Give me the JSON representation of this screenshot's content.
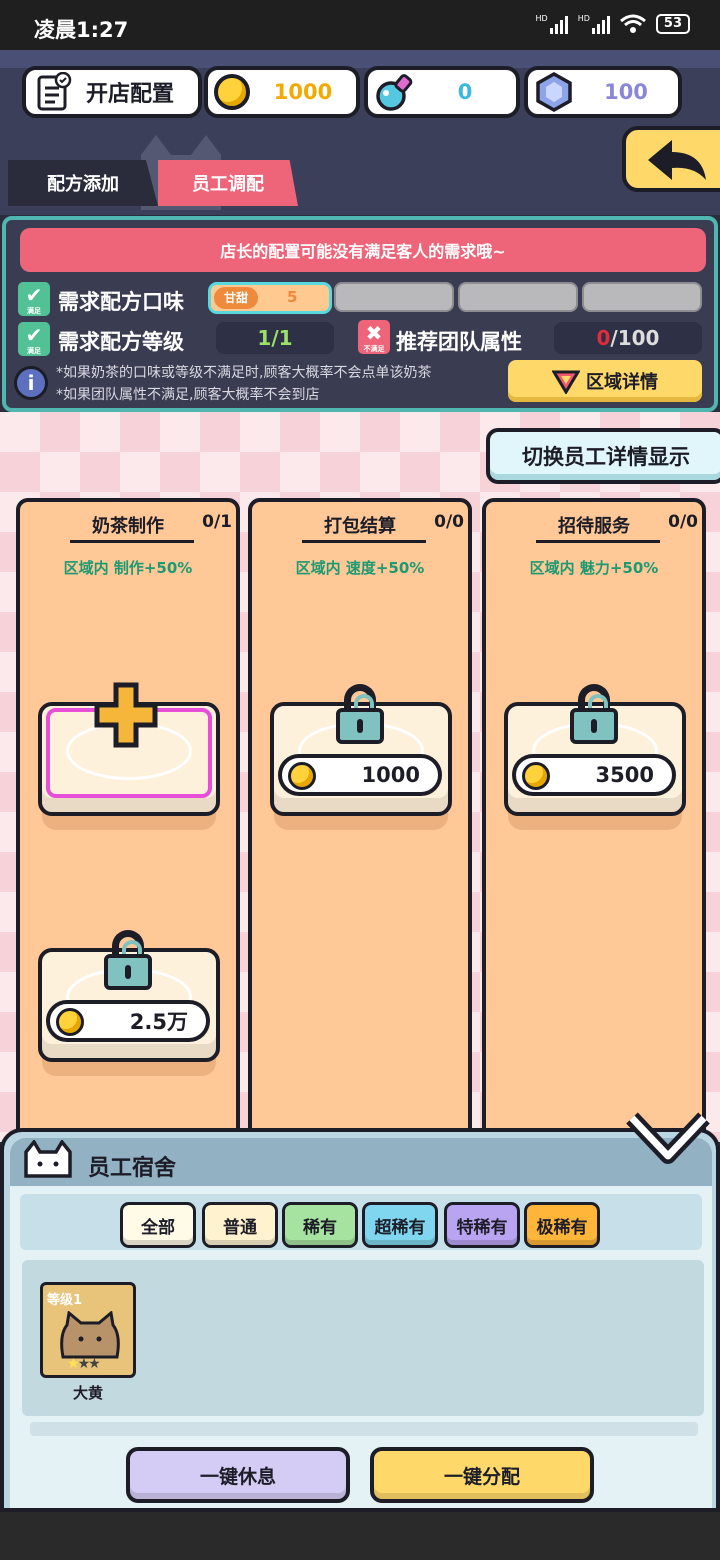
{
  "status_bar": {
    "time": "凌晨1:27",
    "battery": "53",
    "signal1": "HD",
    "signal2": "HD"
  },
  "header": {
    "title": "开店配置",
    "coins": "1000",
    "potion": "0",
    "gems": "100"
  },
  "tabs": [
    {
      "label": "配方添加"
    },
    {
      "label": "员工调配"
    }
  ],
  "info": {
    "warning": "店长的配置可能没有满足客人的需求哦~",
    "req_flavor": {
      "label": "需求配方口味",
      "status": "满足",
      "tag": "甘甜",
      "value": "5"
    },
    "req_level": {
      "label": "需求配方等级",
      "status": "满足",
      "value": "1/1"
    },
    "team": {
      "label": "推荐团队属性",
      "status": "不满足",
      "value_cur": "0",
      "value_total": "/100"
    },
    "notes": [
      "*如果奶茶的口味或等级不满足时,顾客大概率不会点单该奶茶",
      "*如果团队属性不满足,顾客大概率不会到店"
    ],
    "area_btn": "区域详情"
  },
  "switch_label": "切换员工详情显示",
  "columns": [
    {
      "title": "奶茶制作",
      "count": "0/1",
      "bonus": "区域内 制作+50%",
      "unlock_price": "2.5万"
    },
    {
      "title": "打包结算",
      "count": "0/0",
      "bonus": "区域内 速度+50%",
      "unlock_price": "1000"
    },
    {
      "title": "招待服务",
      "count": "0/0",
      "bonus": "区域内 魅力+50%",
      "unlock_price": "3500"
    }
  ],
  "dorm": {
    "title": "员工宿舍",
    "filters": [
      "全部",
      "普通",
      "稀有",
      "超稀有",
      "特稀有",
      "极稀有"
    ],
    "staff": [
      {
        "level": "等级1",
        "name": "大黄",
        "stars": 1,
        "max_stars": 3
      }
    ],
    "rest_all": "一键休息",
    "assign_all": "一键分配"
  },
  "colors": {
    "accent": "#ee6479",
    "coin": "#ffd23b",
    "teal": "#4fb6b0",
    "column": "#ffc896"
  }
}
